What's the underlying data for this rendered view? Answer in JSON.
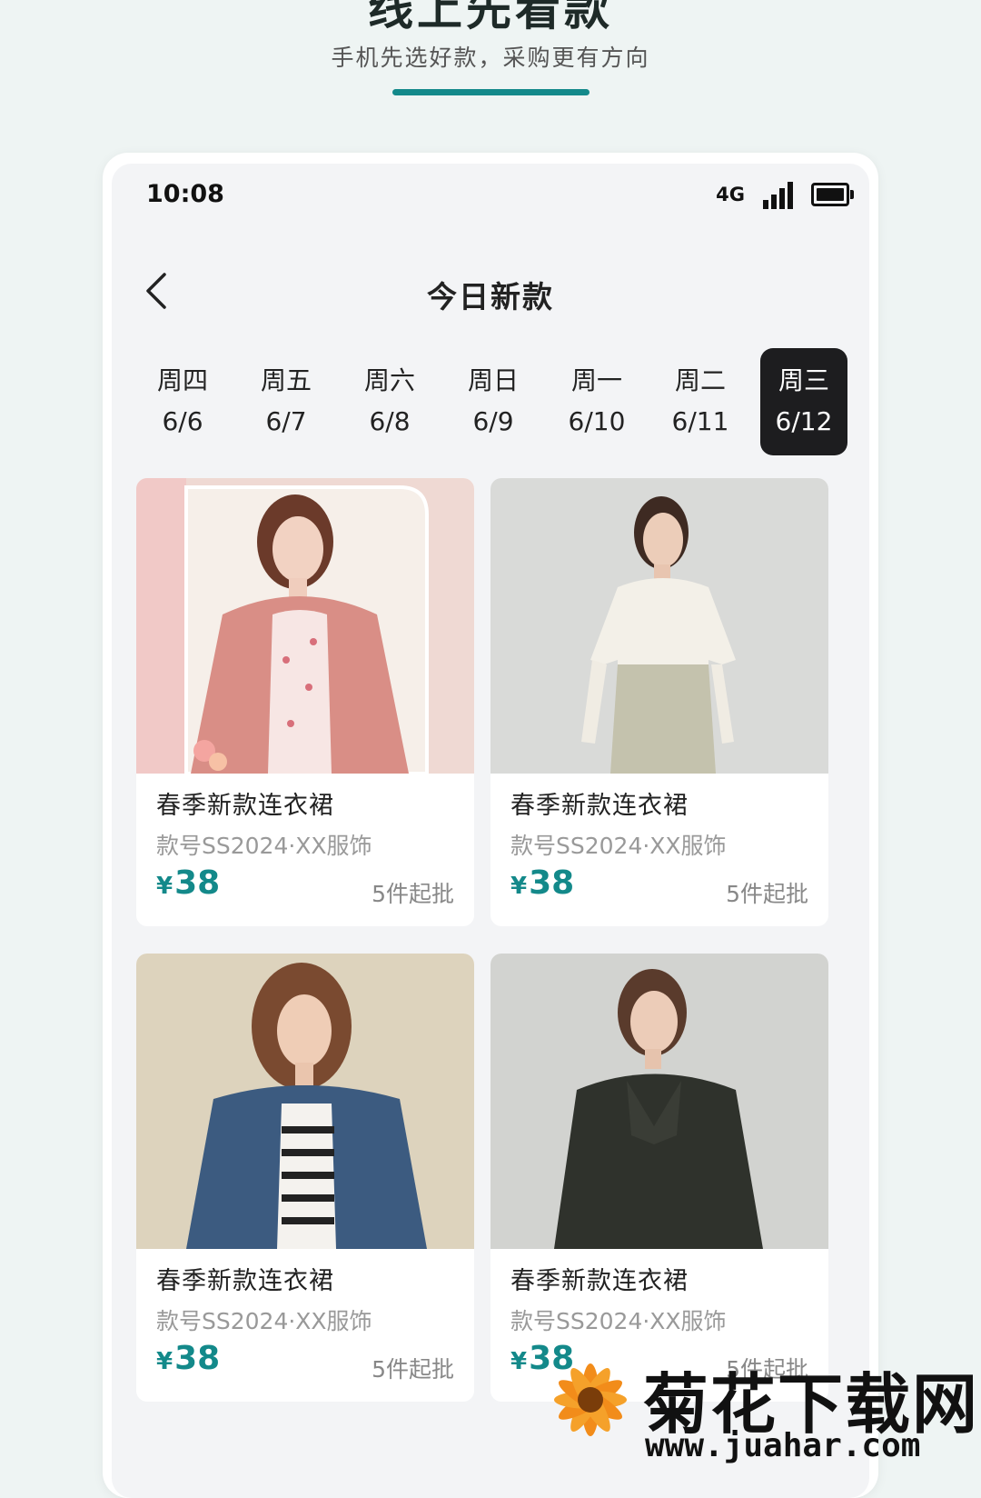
{
  "hero": {
    "title": "线上先看款",
    "subtitle": "手机先选好款，采购更有方向",
    "accent_color": "#13898a"
  },
  "status_bar": {
    "time": "10:08",
    "network": "4G",
    "icons": [
      "signal-icon",
      "battery-icon"
    ]
  },
  "nav": {
    "back_icon": "chevron-left-icon",
    "title": "今日新款"
  },
  "days": [
    {
      "weekday": "周四",
      "date": "6/6",
      "active": false
    },
    {
      "weekday": "周五",
      "date": "6/7",
      "active": false
    },
    {
      "weekday": "周六",
      "date": "6/8",
      "active": false
    },
    {
      "weekday": "周日",
      "date": "6/9",
      "active": false
    },
    {
      "weekday": "周一",
      "date": "6/10",
      "active": false
    },
    {
      "weekday": "周二",
      "date": "6/11",
      "active": false
    },
    {
      "weekday": "周三",
      "date": "6/12",
      "active": true
    }
  ],
  "products": [
    {
      "name": "春季新款连衣裙",
      "code": "款号SS2024·XX服饰",
      "currency": "¥",
      "price": "38",
      "moq": "5件起批",
      "image": "pink-cardigan-photo"
    },
    {
      "name": "春季新款连衣裙",
      "code": "款号SS2024·XX服饰",
      "currency": "¥",
      "price": "38",
      "moq": "5件起批",
      "image": "white-blouse-photo"
    },
    {
      "name": "春季新款连衣裙",
      "code": "款号SS2024·XX服饰",
      "currency": "¥",
      "price": "38",
      "moq": "5件起批",
      "image": "denim-jacket-photo"
    },
    {
      "name": "春季新款连衣裙",
      "code": "款号SS2024·XX服饰",
      "currency": "¥",
      "price": "38",
      "moq": "5件起批",
      "image": "leather-jacket-photo"
    }
  ],
  "watermark": {
    "name": "菊花下载网",
    "url": "www.juahar.com",
    "logo": "orange-flower-logo"
  }
}
